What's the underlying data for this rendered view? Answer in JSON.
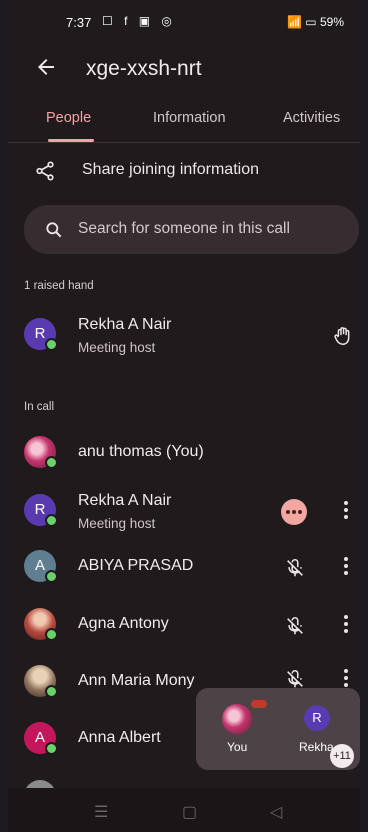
{
  "status_bar": {
    "time": "7:37",
    "notif_icons": "☐ f ▣ ◎",
    "right": "59%"
  },
  "header": {
    "title": "xge-xxsh-nrt"
  },
  "tabs": [
    {
      "label": "People"
    },
    {
      "label": "Information"
    },
    {
      "label": "Activities"
    }
  ],
  "share": {
    "label": "Share joining information"
  },
  "search": {
    "placeholder": "Search for someone in this call"
  },
  "raised_section": {
    "title": "1 raised hand"
  },
  "raised": [
    {
      "initial": "R",
      "name": "Rekha A Nair",
      "role": "Meeting host"
    }
  ],
  "incall_section": {
    "title": "In call"
  },
  "participants": [
    {
      "initial": "",
      "name": "anu thomas (You)",
      "role": ""
    },
    {
      "initial": "R",
      "name": "Rekha A Nair",
      "role": "Meeting host"
    },
    {
      "initial": "A",
      "name": "ABIYA PRASAD",
      "role": ""
    },
    {
      "initial": "",
      "name": "Agna Antony",
      "role": ""
    },
    {
      "initial": "",
      "name": "Ann Maria Mony",
      "role": ""
    },
    {
      "initial": "A",
      "name": "Anna Albert",
      "role": ""
    }
  ],
  "pip": {
    "you_label": "You",
    "other_initial": "R",
    "other_label": "Rekha",
    "badge": "+11"
  },
  "colors": {
    "accent": "#f4a3a7",
    "background": "#1f1a1c",
    "online": "#6bd16b"
  }
}
